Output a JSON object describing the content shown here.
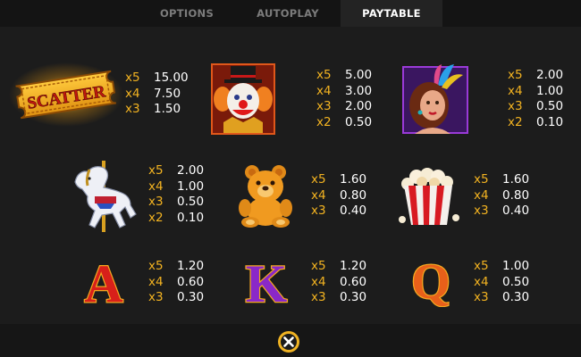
{
  "tabs": [
    {
      "label": "OPTIONS",
      "active": false
    },
    {
      "label": "AUTOPLAY",
      "active": false
    },
    {
      "label": "PAYTABLE",
      "active": true
    }
  ],
  "symbols": [
    {
      "name": "scatter",
      "icon": "scatter-ticket-icon",
      "label": "SCATTER",
      "pays": [
        {
          "mult": "x5",
          "value": "15.00"
        },
        {
          "mult": "x4",
          "value": "7.50"
        },
        {
          "mult": "x3",
          "value": "1.50"
        }
      ]
    },
    {
      "name": "clown",
      "icon": "clown-icon",
      "pays": [
        {
          "mult": "x5",
          "value": "5.00"
        },
        {
          "mult": "x4",
          "value": "3.00"
        },
        {
          "mult": "x3",
          "value": "2.00"
        },
        {
          "mult": "x2",
          "value": "0.50"
        }
      ]
    },
    {
      "name": "showgirl",
      "icon": "showgirl-icon",
      "pays": [
        {
          "mult": "x5",
          "value": "2.00"
        },
        {
          "mult": "x4",
          "value": "1.00"
        },
        {
          "mult": "x3",
          "value": "0.50"
        },
        {
          "mult": "x2",
          "value": "0.10"
        }
      ]
    },
    {
      "name": "carousel-horse",
      "icon": "carousel-horse-icon",
      "pays": [
        {
          "mult": "x5",
          "value": "2.00"
        },
        {
          "mult": "x4",
          "value": "1.00"
        },
        {
          "mult": "x3",
          "value": "0.50"
        },
        {
          "mult": "x2",
          "value": "0.10"
        }
      ]
    },
    {
      "name": "teddy-bear",
      "icon": "teddy-bear-icon",
      "pays": [
        {
          "mult": "x5",
          "value": "1.60"
        },
        {
          "mult": "x4",
          "value": "0.80"
        },
        {
          "mult": "x3",
          "value": "0.40"
        }
      ]
    },
    {
      "name": "popcorn",
      "icon": "popcorn-icon",
      "pays": [
        {
          "mult": "x5",
          "value": "1.60"
        },
        {
          "mult": "x4",
          "value": "0.80"
        },
        {
          "mult": "x3",
          "value": "0.40"
        }
      ]
    },
    {
      "name": "letter-a",
      "icon": "letter-a-icon",
      "label": "A",
      "pays": [
        {
          "mult": "x5",
          "value": "1.20"
        },
        {
          "mult": "x4",
          "value": "0.60"
        },
        {
          "mult": "x3",
          "value": "0.30"
        }
      ]
    },
    {
      "name": "letter-k",
      "icon": "letter-k-icon",
      "label": "K",
      "pays": [
        {
          "mult": "x5",
          "value": "1.20"
        },
        {
          "mult": "x4",
          "value": "0.60"
        },
        {
          "mult": "x3",
          "value": "0.30"
        }
      ]
    },
    {
      "name": "letter-q",
      "icon": "letter-q-icon",
      "label": "Q",
      "pays": [
        {
          "mult": "x5",
          "value": "1.00"
        },
        {
          "mult": "x4",
          "value": "0.50"
        },
        {
          "mult": "x3",
          "value": "0.30"
        }
      ]
    }
  ],
  "close_button": {
    "icon": "close-icon"
  },
  "colors": {
    "background": "#1c1c1c",
    "tab_active": "#232323",
    "tab_inactive_text": "#7c7c7c",
    "multiplier": "#f3b321",
    "value": "#ffffff",
    "close_button": "#f0b323"
  }
}
